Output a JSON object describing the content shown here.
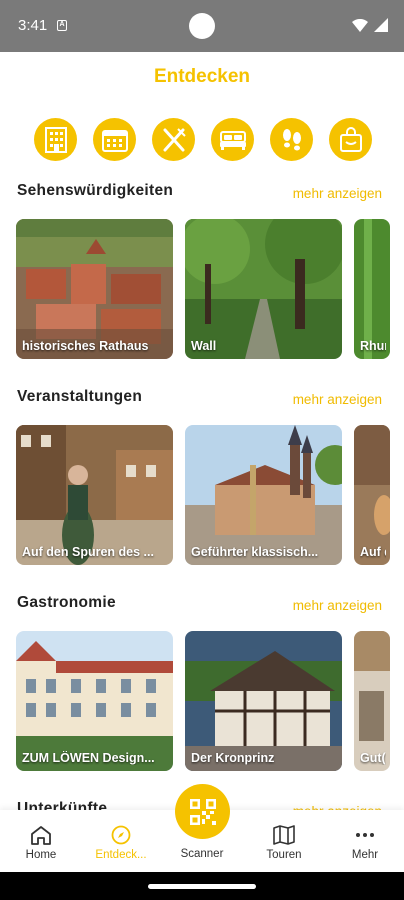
{
  "status": {
    "time": "3:41",
    "a_badge": "A"
  },
  "header": {
    "title": "Entdecken"
  },
  "categories": [
    {
      "icon": "building-icon"
    },
    {
      "icon": "calendar-icon"
    },
    {
      "icon": "fork-knife-icon"
    },
    {
      "icon": "bed-icon"
    },
    {
      "icon": "footprints-icon"
    },
    {
      "icon": "shopping-bag-icon"
    }
  ],
  "sections": [
    {
      "title": "Sehenswürdigkeiten",
      "more": "mehr anzeigen",
      "cards": [
        "historisches Rathaus",
        "Wall",
        "Rhun"
      ]
    },
    {
      "title": "Veranstaltungen",
      "more": "mehr anzeigen",
      "cards": [
        "Auf den Spuren des ...",
        "Geführter klassisch...",
        "Auf d"
      ]
    },
    {
      "title": "Gastronomie",
      "more": "mehr anzeigen",
      "cards": [
        "ZUM LÖWEN Design...",
        "Der Kronprinz",
        "Gut("
      ]
    },
    {
      "title": "Unterkünfte",
      "more": "mehr anzeigen"
    }
  ],
  "nav": {
    "home": "Home",
    "discover": "Entdeck...",
    "scanner": "Scanner",
    "tours": "Touren",
    "more": "Mehr"
  },
  "colors": {
    "accent": "#f5c200",
    "status_bar": "#7a7a7a"
  }
}
